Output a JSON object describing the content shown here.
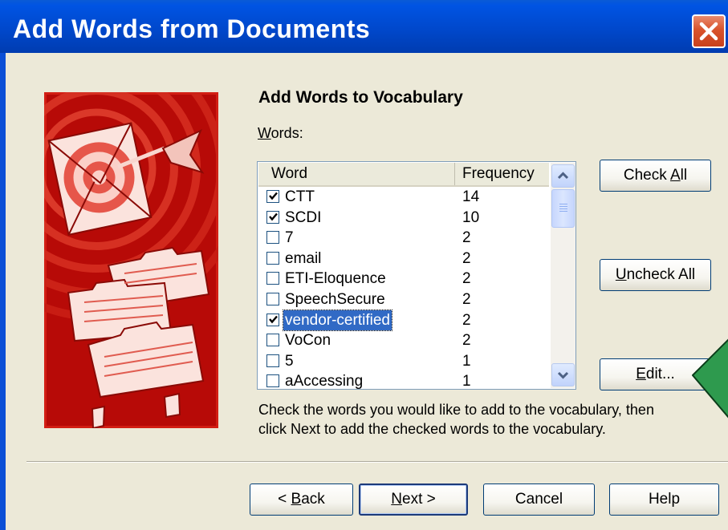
{
  "window": {
    "title": "Add Words from Documents"
  },
  "page": {
    "heading": "Add Words to Vocabulary",
    "words_label_mnemonic": "W",
    "words_label_rest": "ords:",
    "instructions_line1": "Check the words you would like to add to the vocabulary, then",
    "instructions_line2": "click Next to add the checked words to the vocabulary."
  },
  "list": {
    "columns": {
      "word": "Word",
      "frequency": "Frequency"
    },
    "rows": [
      {
        "word": "CTT",
        "frequency": "14",
        "checked": true
      },
      {
        "word": "SCDI",
        "frequency": "10",
        "checked": true
      },
      {
        "word": "7",
        "frequency": "2",
        "checked": false
      },
      {
        "word": "email",
        "frequency": "2",
        "checked": false
      },
      {
        "word": "ETI-Eloquence",
        "frequency": "2",
        "checked": false
      },
      {
        "word": "SpeechSecure",
        "frequency": "2",
        "checked": false
      },
      {
        "word": "vendor-certified",
        "frequency": "2",
        "checked": true,
        "selected": true
      },
      {
        "word": "VoCon",
        "frequency": "2",
        "checked": false
      },
      {
        "word": "5",
        "frequency": "1",
        "checked": false
      },
      {
        "word": "aAccessing",
        "frequency": "1",
        "checked": false
      }
    ]
  },
  "buttons": {
    "check_all": {
      "pre": "Check ",
      "key": "A",
      "post": "ll"
    },
    "uncheck_all": {
      "pre": "",
      "key": "U",
      "post": "ncheck All"
    },
    "edit": {
      "pre": "",
      "key": "E",
      "post": "dit..."
    },
    "back": {
      "pre": "< ",
      "key": "B",
      "post": "ack"
    },
    "next": {
      "pre": "",
      "key": "N",
      "post": "ext >"
    },
    "cancel": {
      "label": "Cancel"
    },
    "help": {
      "label": "Help"
    }
  },
  "icons": {
    "close": "close-icon",
    "scroll_up": "chevron-up-icon",
    "scroll_down": "chevron-down-icon",
    "illustration": "target-envelope-dart-illustration",
    "pointer": "green-arrow-pointer-icon"
  },
  "colors": {
    "titlebar": "#0054e3",
    "selection": "#316ac5",
    "art_background": "#b70a07",
    "pointer_arrow": "#2e9a4e"
  }
}
